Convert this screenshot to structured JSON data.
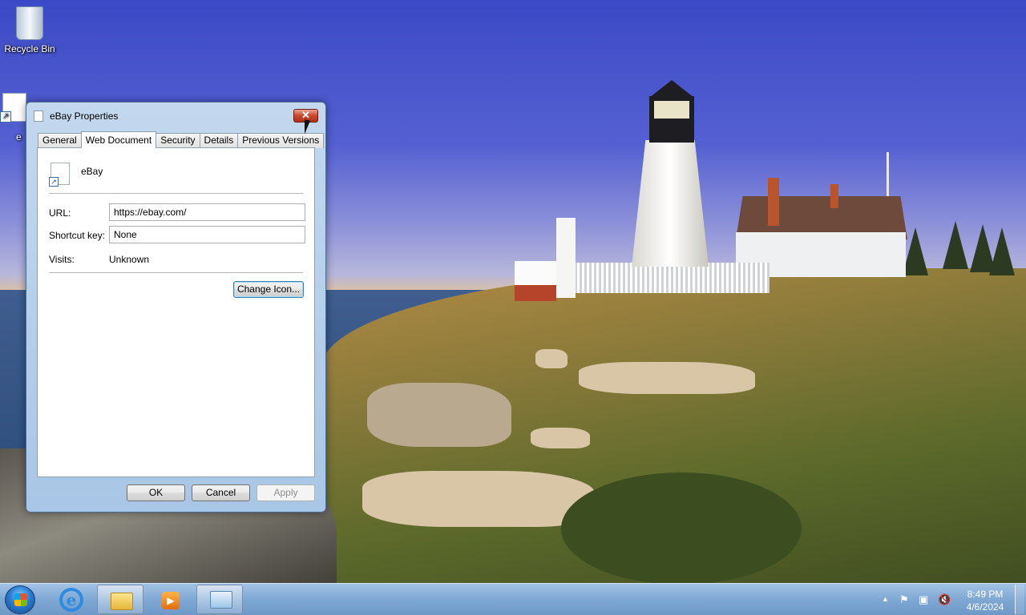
{
  "desktop": {
    "icons": [
      {
        "label": "Recycle Bin"
      },
      {
        "label": "e"
      }
    ]
  },
  "dialog": {
    "title": "eBay Properties",
    "close_symbol": "✕",
    "tabs": [
      {
        "label": "General"
      },
      {
        "label": "Web Document"
      },
      {
        "label": "Security"
      },
      {
        "label": "Details"
      },
      {
        "label": "Previous Versions"
      }
    ],
    "active_tab": "Web Document",
    "shortcut_name": "eBay",
    "url_label": "URL:",
    "url_value": "https://ebay.com/",
    "shortcut_key_label": "Shortcut key:",
    "shortcut_key_value": "None",
    "visits_label": "Visits:",
    "visits_value": "Unknown",
    "change_icon_label": "Change Icon...",
    "ok_label": "OK",
    "cancel_label": "Cancel",
    "apply_label": "Apply"
  },
  "taskbar": {
    "clock_time": "8:49 PM",
    "clock_date": "4/6/2024",
    "tray_up_symbol": "▲",
    "ie_letter": "e",
    "media_symbol": "▶",
    "icons": [
      "start-orb-icon",
      "internet-explorer-icon",
      "file-explorer-icon",
      "media-player-icon",
      "control-panel-icon",
      "action-center-flag-icon",
      "network-icon",
      "volume-muted-icon"
    ]
  },
  "colors": {
    "title_close": "#c9462a",
    "taskbar": "#7fa8d4",
    "sky": "#3b49c6"
  }
}
